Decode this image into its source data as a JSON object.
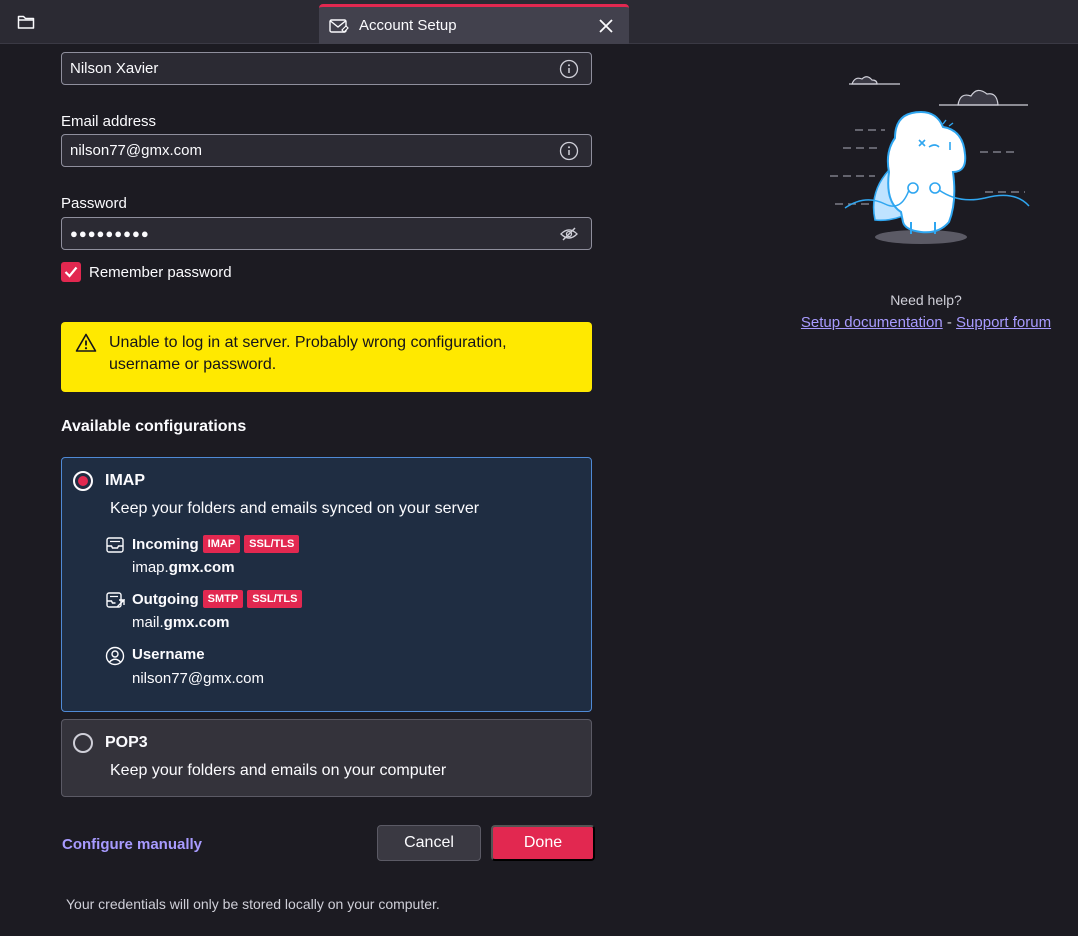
{
  "tab": {
    "title": "Account Setup"
  },
  "form": {
    "full_name_value": "Nilson Xavier",
    "email_label": "Email address",
    "email_value": "nilson77@gmx.com",
    "password_label": "Password",
    "password_value": "●●●●●●●●●",
    "remember_label": "Remember password"
  },
  "warning": {
    "text": "Unable to log in at server. Probably wrong configuration, username or password."
  },
  "configs": {
    "title": "Available configurations",
    "imap": {
      "name": "IMAP",
      "description": "Keep your folders and emails synced on your server",
      "incoming_label": "Incoming",
      "incoming_badge_protocol": "IMAP",
      "incoming_badge_security": "SSL/TLS",
      "incoming_host_prefix": "imap.",
      "incoming_host_domain": "gmx.com",
      "outgoing_label": "Outgoing",
      "outgoing_badge_protocol": "SMTP",
      "outgoing_badge_security": "SSL/TLS",
      "outgoing_host_prefix": "mail.",
      "outgoing_host_domain": "gmx.com",
      "username_label": "Username",
      "username_value": "nilson77@gmx.com"
    },
    "pop3": {
      "name": "POP3",
      "description": "Keep your folders and emails on your computer"
    }
  },
  "actions": {
    "configure_manually": "Configure manually",
    "cancel": "Cancel",
    "done": "Done"
  },
  "footnote": "Your credentials will only be stored locally on your computer.",
  "help": {
    "title": "Need help?",
    "doc_link": "Setup documentation",
    "separator": " - ",
    "forum_link": "Support forum"
  },
  "colors": {
    "accent": "#e22850",
    "warning_bg": "#ffe900",
    "link": "#a89bff",
    "selected_border": "#4f8ad6"
  }
}
